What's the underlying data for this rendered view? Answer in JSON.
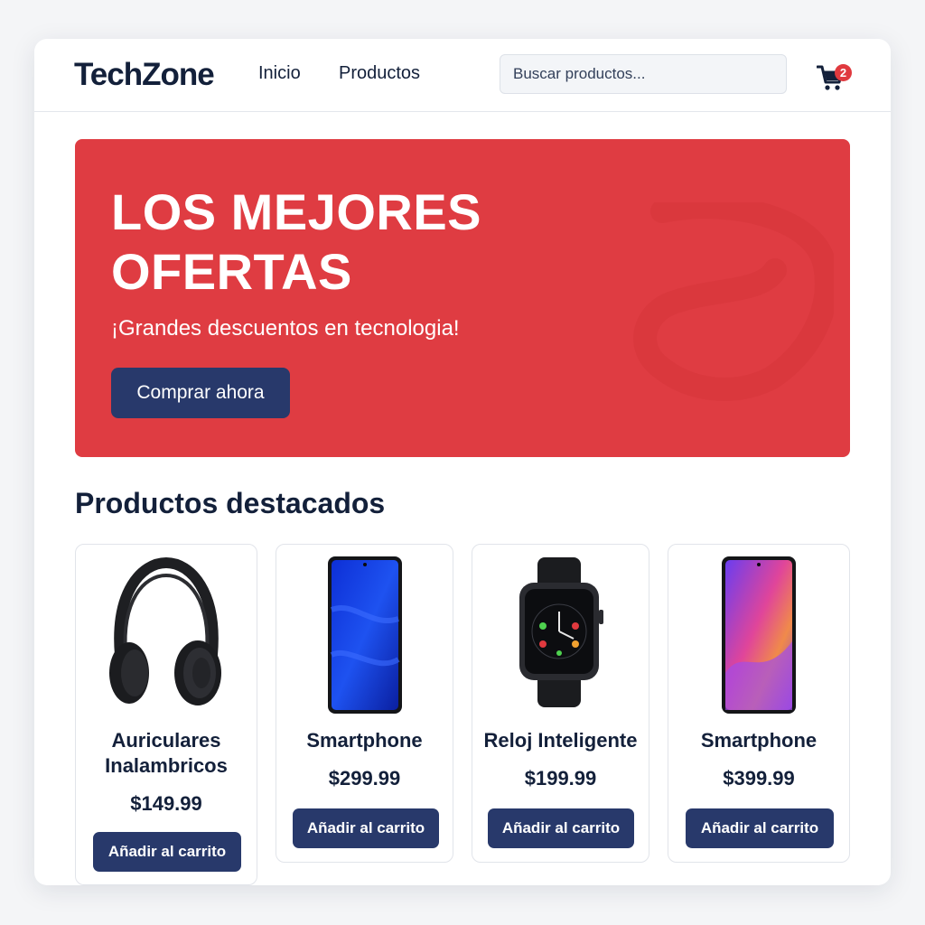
{
  "header": {
    "logo": "TechZone",
    "nav": [
      {
        "label": "Inicio"
      },
      {
        "label": "Productos"
      }
    ],
    "search": {
      "placeholder": "Buscar productos...",
      "value": ""
    },
    "cart": {
      "icon": "cart-icon",
      "count": "2"
    }
  },
  "hero": {
    "title_line1": "LOS MEJORES",
    "title_line2": "OFERTAS",
    "subtitle": "¡Grandes descuentos en tecnologia!",
    "cta_label": "Comprar ahora",
    "background_color": "#df3c42"
  },
  "featured": {
    "title": "Productos destacados",
    "products": [
      {
        "name": "Auriculares Inalambricos",
        "price": "$149.99",
        "button": "Añadir al carrito",
        "icon": "headphones-icon"
      },
      {
        "name": "Smartphone",
        "price": "$299.99",
        "button": "Añadir al carrito",
        "icon": "smartphone-icon"
      },
      {
        "name": "Reloj Inteligente",
        "price": "$199.99",
        "button": "Añadir al carrito",
        "icon": "smartwatch-icon"
      },
      {
        "name": "Smartphone",
        "price": "$399.99",
        "button": "Añadir al carrito",
        "icon": "smartphone-icon"
      }
    ]
  },
  "colors": {
    "primary": "#28396b",
    "accent": "#df3c42",
    "text": "#13203a"
  }
}
